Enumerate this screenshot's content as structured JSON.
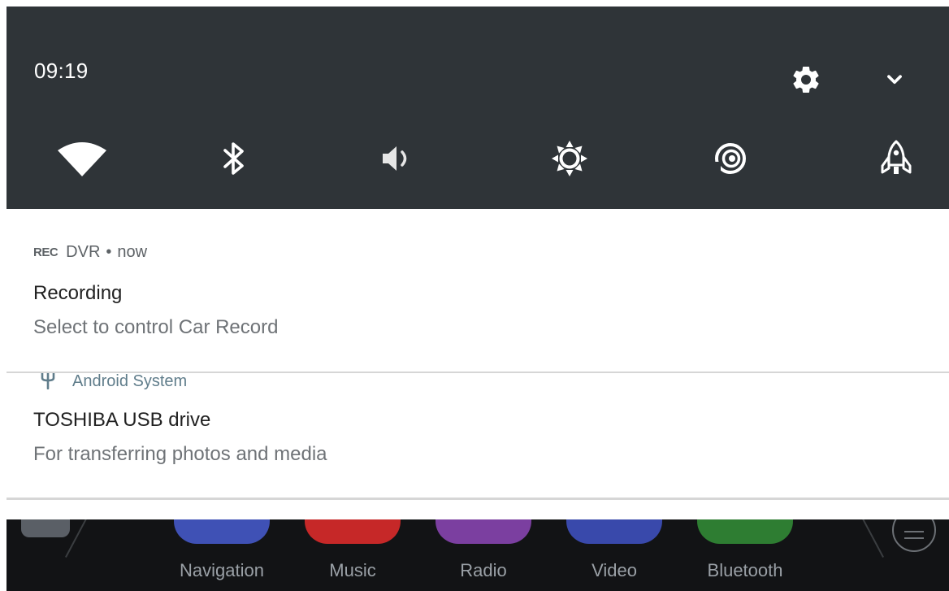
{
  "status": {
    "time": "09:19"
  },
  "quick_settings": {
    "header_icons": [
      "gear-icon",
      "chevron-down-icon"
    ],
    "tiles": [
      {
        "name": "wifi",
        "icon": "wifi-icon"
      },
      {
        "name": "bluetooth",
        "icon": "bluetooth-icon"
      },
      {
        "name": "volume",
        "icon": "volume-icon"
      },
      {
        "name": "brightness",
        "icon": "brightness-icon"
      },
      {
        "name": "hotspot",
        "icon": "hotspot-icon"
      },
      {
        "name": "boost",
        "icon": "rocket-icon"
      }
    ],
    "colors": {
      "panel": "#2f3438",
      "icon": "#ffffff"
    }
  },
  "notifications": [
    {
      "app_icon": "REC",
      "app_name": "DVR",
      "separator": "•",
      "time": "now",
      "title": "Recording",
      "text": "Select to control Car Record"
    },
    {
      "app_icon": "usb-icon",
      "app_name": "Android System",
      "title": "TOSHIBA USB drive",
      "text": "For transferring photos and media",
      "accent": "#607d8b"
    }
  ],
  "dock": {
    "apps": [
      {
        "label": "Navigation",
        "color": "#3f51b5"
      },
      {
        "label": "Music",
        "color": "#c62828"
      },
      {
        "label": "Radio",
        "color": "#7b3fa0"
      },
      {
        "label": "Video",
        "color": "#3949ab"
      },
      {
        "label": "Bluetooth",
        "color": "#2e7d32"
      }
    ]
  }
}
